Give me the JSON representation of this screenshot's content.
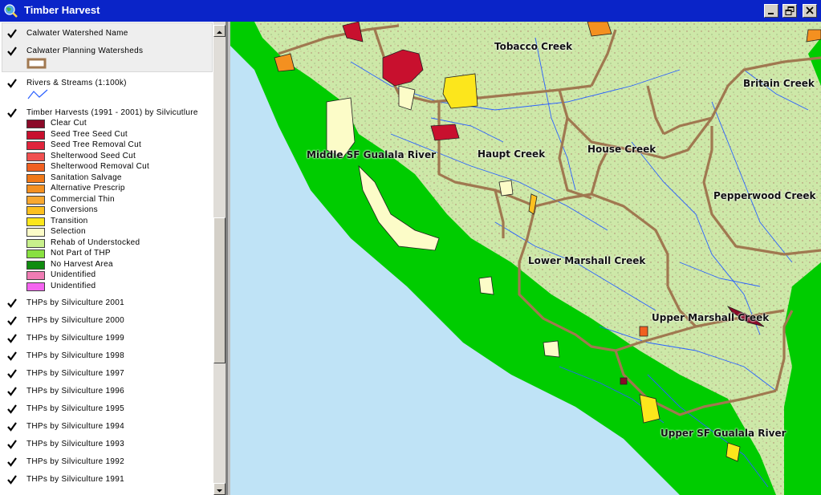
{
  "window": {
    "title": "Timber Harvest"
  },
  "toc": {
    "watershed_name": "Calwater Watershed Name",
    "planning_watersheds": "Calwater Planning Watersheds",
    "rivers": "Rivers & Streams (1:100k)",
    "timber_harvests": "Timber Harvests (1991 - 2001) by Silvicutlure",
    "legend": [
      {
        "label": "Clear Cut",
        "color": "#8b0a28"
      },
      {
        "label": "Seed Tree Seed Cut",
        "color": "#c8102e"
      },
      {
        "label": "Seed Tree Removal Cut",
        "color": "#e0243c"
      },
      {
        "label": "Shelterwood Seed Cut",
        "color": "#f05050"
      },
      {
        "label": "Shelterwood Removal Cut",
        "color": "#f06020"
      },
      {
        "label": "Sanitation Salvage",
        "color": "#f07818"
      },
      {
        "label": "Alternative Prescrip",
        "color": "#f49020"
      },
      {
        "label": "Commercial Thin",
        "color": "#f8a830"
      },
      {
        "label": "Conversions",
        "color": "#fcc020"
      },
      {
        "label": "Transition",
        "color": "#fce61c"
      },
      {
        "label": "Selection",
        "color": "#fcfcc8"
      },
      {
        "label": "Rehab of Understocked",
        "color": "#c8f08c"
      },
      {
        "label": "Not Part of THP",
        "color": "#88e040"
      },
      {
        "label": "No Harvest Area",
        "color": "#108c10"
      },
      {
        "label": "Unidentified",
        "color": "#f07cb4"
      },
      {
        "label": "Unidentified",
        "color": "#f464f0"
      }
    ],
    "thp_layers": [
      "THPs by Silviculture 2001",
      "THPs by Silviculture 2000",
      "THPs by Silviculture 1999",
      "THPs by Silviculture 1998",
      "THPs by Silviculture 1997",
      "THPs by Silviculture 1996",
      "THPs by Silviculture 1995",
      "THPs by Silviculture 1994",
      "THPs by Silviculture 1993",
      "THPs by Silviculture 1992",
      "THPs by Silviculture 1991"
    ]
  },
  "map": {
    "labels": {
      "tobacco": "Tobacco Creek",
      "britain": "Britain Creek",
      "middle_sf": "Middle SF Gualala River",
      "haupt": "Haupt Creek",
      "house": "House Creek",
      "pepperwood": "Pepperwood Creek",
      "lower_marshall": "Lower Marshall Creek",
      "upper_marshall": "Upper Marshall Creek",
      "upper_sf": "Upper SF Gualala River"
    },
    "colors": {
      "ocean": "#bfe3f6",
      "coast": "#00cc00",
      "land": "#cde8a8",
      "watershed": "#a07850",
      "stream": "#2a60ff"
    }
  }
}
